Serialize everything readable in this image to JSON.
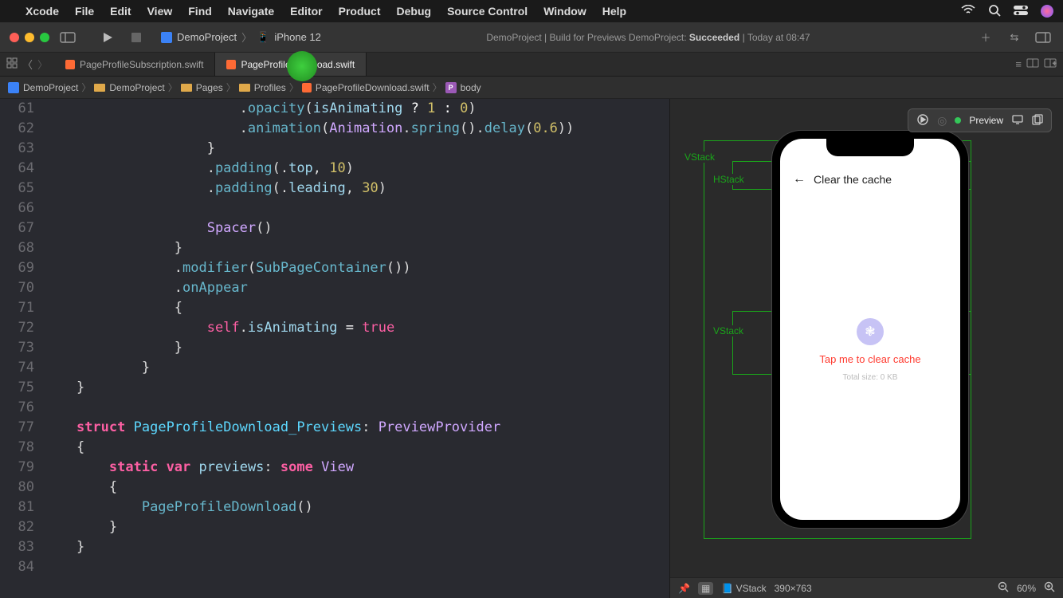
{
  "menubar": {
    "app": "Xcode",
    "items": [
      "File",
      "Edit",
      "View",
      "Find",
      "Navigate",
      "Editor",
      "Product",
      "Debug",
      "Source Control",
      "Window",
      "Help"
    ]
  },
  "toolbar": {
    "scheme_project": "DemoProject",
    "scheme_device": "iPhone 12",
    "status_prefix": "DemoProject | Build for Previews DemoProject: ",
    "status_result": "Succeeded",
    "status_time": " | Today at 08:47"
  },
  "tabs": [
    {
      "name": "PageProfileSubscription.swift"
    },
    {
      "name": "PageProfileDownload.swift"
    }
  ],
  "jumpbar": {
    "items": [
      "DemoProject",
      "DemoProject",
      "Pages",
      "Profiles",
      "PageProfileDownload.swift",
      "body"
    ]
  },
  "code_lines": [
    {
      "n": 61,
      "html": "                        .<span class='tk-method'>opacity</span>(<span class='tk-id'>isAnimating</span> <span class='tk-op'>?</span> <span class='tk-num'>1</span> <span class='tk-op'>:</span> <span class='tk-num'>0</span>)"
    },
    {
      "n": 62,
      "html": "                        .<span class='tk-method'>animation</span>(<span class='tk-type'>Animation</span>.<span class='tk-method'>spring</span>().<span class='tk-method'>delay</span>(<span class='tk-num'>0.6</span>))"
    },
    {
      "n": 63,
      "html": "                    }"
    },
    {
      "n": 64,
      "html": "                    .<span class='tk-method'>padding</span>(.<span class='tk-enum'>top</span>, <span class='tk-num'>10</span>)"
    },
    {
      "n": 65,
      "html": "                    .<span class='tk-method'>padding</span>(.<span class='tk-enum'>leading</span>, <span class='tk-num'>30</span>)"
    },
    {
      "n": 66,
      "html": ""
    },
    {
      "n": 67,
      "html": "                    <span class='tk-type'>Spacer</span>()"
    },
    {
      "n": 68,
      "html": "                }"
    },
    {
      "n": 69,
      "html": "                .<span class='tk-method'>modifier</span>(<span class='tk-call'>SubPageContainer</span>())"
    },
    {
      "n": 70,
      "html": "                .<span class='tk-method'>onAppear</span>"
    },
    {
      "n": 71,
      "html": "                {"
    },
    {
      "n": 72,
      "html": "                    <span class='tk-self'>self</span>.<span class='tk-id'>isAnimating</span> <span class='tk-op'>=</span> <span class='tk-bool'>true</span>"
    },
    {
      "n": 73,
      "html": "                }"
    },
    {
      "n": 74,
      "html": "            }"
    },
    {
      "n": 75,
      "html": "    }"
    },
    {
      "n": 76,
      "html": ""
    },
    {
      "n": 77,
      "html": "    <span class='tk-kw'>struct</span> <span class='tk-structname'>PageProfileDownload_Previews</span>: <span class='tk-type'>PreviewProvider</span>"
    },
    {
      "n": 78,
      "html": "    {"
    },
    {
      "n": 79,
      "html": "        <span class='tk-kw'>static</span> <span class='tk-kw'>var</span> <span class='tk-id'>previews</span>: <span class='tk-kw'>some</span> <span class='tk-type'>View</span>"
    },
    {
      "n": 80,
      "html": "        {"
    },
    {
      "n": 81,
      "html": "            <span class='tk-call'>PageProfileDownload</span>()"
    },
    {
      "n": 82,
      "html": "        }"
    },
    {
      "n": 83,
      "html": "    }"
    },
    {
      "n": 84,
      "html": ""
    }
  ],
  "preview": {
    "label": "Preview",
    "phone": {
      "header_title": "Clear the cache",
      "tap_text": "Tap me to clear cache",
      "size_text": "Total size: 0 KB"
    },
    "overlays": {
      "vstack1": "VStack",
      "hstack": "HStack",
      "vstack2": "VStack"
    },
    "bottombar": {
      "element": "VStack",
      "dims": "390×763",
      "zoom": "60%"
    }
  }
}
